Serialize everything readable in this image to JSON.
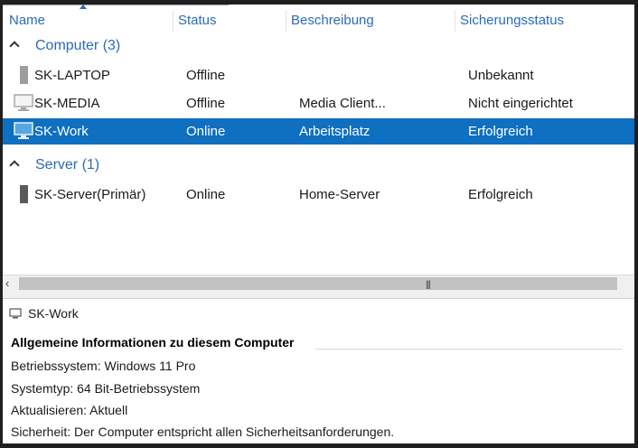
{
  "columns": {
    "name": "Name",
    "status": "Status",
    "description": "Beschreibung",
    "backup_status": "Sicherungsstatus"
  },
  "groups": [
    {
      "name": "Computer",
      "count": "(3)"
    },
    {
      "name": "Server",
      "count": "(1)"
    }
  ],
  "rows": [
    {
      "name": "SK-LAPTOP",
      "status": "Offline",
      "description": "",
      "backup": "Unbekannt",
      "icon": "laptop-tower-icon"
    },
    {
      "name": "SK-MEDIA",
      "status": "Offline",
      "description": "Media Client...",
      "backup": "Nicht eingerichtet",
      "icon": "monitor-icon"
    },
    {
      "name": "SK-Work",
      "status": "Online",
      "description": "Arbeitsplatz",
      "backup": "Erfolgreich",
      "icon": "monitor-icon",
      "selected": true
    },
    {
      "name": "SK-Server(Primär)",
      "status": "Online",
      "description": "Home-Server",
      "backup": "Erfolgreich",
      "icon": "server-tower-icon"
    }
  ],
  "details": {
    "title": "SK-Work",
    "section": "Allgemeine Informationen zu diesem Computer",
    "lines": [
      "Betriebssystem: Windows 11 Pro",
      "Systemtyp: 64 Bit-Betriebssystem",
      "Aktualisieren: Aktuell",
      "Sicherheit: Der Computer entspricht allen Sicherheitsanforderungen."
    ]
  },
  "colors": {
    "accent": "#2b6cb3",
    "selection": "#0f6fc0"
  }
}
